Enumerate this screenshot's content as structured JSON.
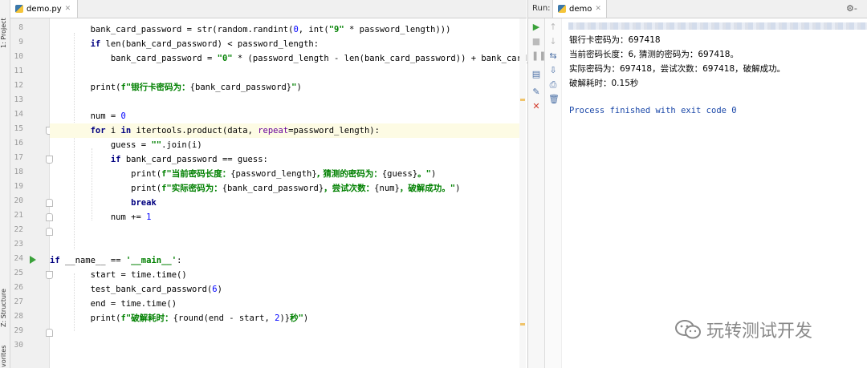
{
  "sidebar": {
    "project_label": "1: Project",
    "structure_label": "Z: Structure",
    "favorites_label": "vorites"
  },
  "editor": {
    "tab_label": "demo.py",
    "line_numbers": [
      "8",
      "9",
      "10",
      "11",
      "12",
      "13",
      "14",
      "15",
      "16",
      "17",
      "18",
      "19",
      "20",
      "21",
      "22",
      "23",
      "24",
      "25",
      "26",
      "27",
      "28",
      "29",
      "30"
    ],
    "current_line": "15",
    "run_gutter_line": "24"
  },
  "run": {
    "label": "Run:",
    "tab_label": "demo",
    "output": [
      "银行卡密码为：697418",
      "当前密码长度：6, 猜测的密码为：697418。",
      "实际密码为：697418，尝试次数：697418，破解成功。",
      "破解耗时：0.15秒"
    ],
    "process_message": "Process finished with exit code 0"
  },
  "watermark": {
    "text": "玩转测试开发"
  },
  "colors": {
    "keyword": "#000080",
    "string": "#008000",
    "number": "#0000ff",
    "param": "#660099",
    "current_line": "#fdfbe4",
    "run_green": "#3aa13a"
  }
}
